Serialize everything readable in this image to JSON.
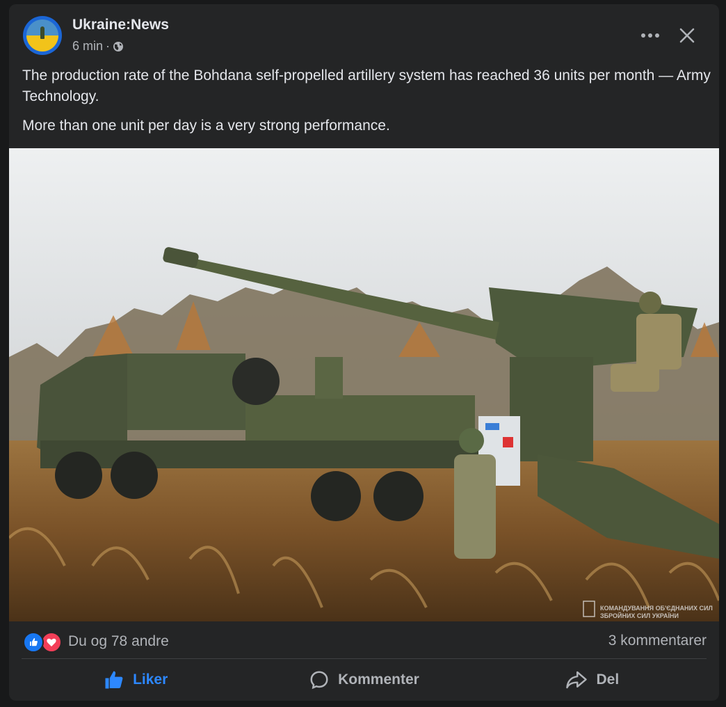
{
  "post": {
    "author": "Ukraine:News",
    "time": "6 min",
    "separator": "·",
    "privacy_icon": "globe-icon",
    "paragraphs": [
      "The production rate of the Bohdana self-propelled artillery system has reached 36 units per month — Army Technology.",
      "More than one unit per day is a very strong performance."
    ],
    "image_alt": "Bohdana self-propelled howitzer on an 8x8 truck chassis in a field with soldiers",
    "watermark": [
      "КОМАНДУВАННЯ ОБ'ЄДНАНИХ СИЛ",
      "ЗБРОЙНИХ СИЛ УКРАЇНИ"
    ]
  },
  "header_actions": {
    "more_icon": "more-dots-icon",
    "close_icon": "close-icon"
  },
  "stats": {
    "reaction_icons": [
      "like-icon",
      "love-icon"
    ],
    "reactions_text": "Du og 78 andre",
    "comments_text": "3 kommentarer"
  },
  "actions": {
    "like_label": "Liker",
    "comment_label": "Kommenter",
    "share_label": "Del"
  },
  "colors": {
    "card_bg": "#242526",
    "page_bg": "#18191a",
    "text_primary": "#e4e6eb",
    "text_secondary": "#b0b3b8",
    "like_blue": "#2d88ff",
    "love_red": "#f33e58"
  }
}
